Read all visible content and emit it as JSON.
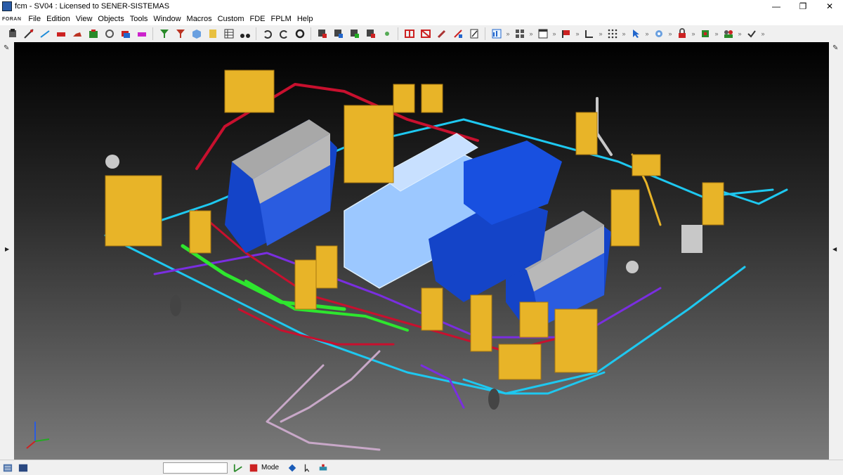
{
  "window": {
    "title": "fcm - SV04 : Licensed to SENER-SISTEMAS",
    "minimize": "—",
    "restore": "❐",
    "close": "✕"
  },
  "brand": "FORAN",
  "menu": [
    "File",
    "Edition",
    "View",
    "Objects",
    "Tools",
    "Window",
    "Macros",
    "Custom",
    "FDE",
    "FPLM",
    "Help"
  ],
  "status": {
    "mode_label": "Mode",
    "input_value": ""
  },
  "colors": {
    "pipe_red": "#c8102e",
    "pipe_green": "#2ee62e",
    "pipe_cyan": "#1ec8f0",
    "pipe_purple": "#7a2ee0",
    "equipment_yellow": "#e8b428",
    "engine_blue": "#1444c8",
    "engine_grey": "#a8a8a8",
    "selected_engine": "#9cc8ff"
  }
}
